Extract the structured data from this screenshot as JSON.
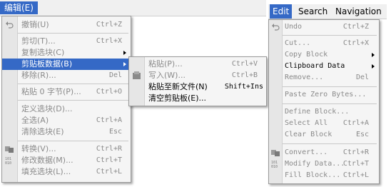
{
  "left": {
    "menubar_title": "编辑(E)",
    "items": [
      {
        "label": "撤销(U)",
        "shortcut": "Ctrl+Z",
        "disabled": true,
        "icon": "undo-icon"
      },
      {
        "label": "剪切(T)...",
        "shortcut": "Ctrl+X",
        "disabled": true
      },
      {
        "label": "复制选块(C)",
        "shortcut": "",
        "disabled": true,
        "submenu": true
      },
      {
        "label": "剪贴板数据(B)",
        "shortcut": "",
        "disabled": false,
        "submenu": true,
        "selected": true
      },
      {
        "label": "移除(R)...",
        "shortcut": "Del",
        "disabled": true
      },
      {
        "label": "粘贴 0 字节(P)...",
        "shortcut": "Ctrl+O",
        "disabled": true
      },
      {
        "label": "定义选块(D)...",
        "shortcut": "",
        "disabled": true
      },
      {
        "label": "全选(A)",
        "shortcut": "Ctrl+A",
        "disabled": true
      },
      {
        "label": "清除选块(E)",
        "shortcut": "Esc",
        "disabled": true
      },
      {
        "label": "转换(V)...",
        "shortcut": "Ctrl+R",
        "disabled": true,
        "icon": "convert-icon"
      },
      {
        "label": "修改数据(M)...",
        "shortcut": "Ctrl+T",
        "disabled": true,
        "icon": "binary-icon"
      },
      {
        "label": "填充选块(L)...",
        "shortcut": "Ctrl+L",
        "disabled": true
      }
    ],
    "submenu": [
      {
        "label": "粘贴(P)...",
        "shortcut": "Ctrl+V",
        "disabled": true
      },
      {
        "label": "写入(W)...",
        "shortcut": "Ctrl+B",
        "disabled": true,
        "icon": "write-icon"
      },
      {
        "label": "粘贴至新文件(N)",
        "shortcut": "Shift+Ins",
        "disabled": false
      },
      {
        "label": "清空剪贴板(E)...",
        "shortcut": "",
        "disabled": false
      }
    ]
  },
  "right": {
    "menubar": [
      "Edit",
      "Search",
      "Navigation"
    ],
    "items": [
      {
        "label": "Undo",
        "shortcut": "Ctrl+Z",
        "disabled": true,
        "icon": "undo-icon"
      },
      {
        "label": "Cut...",
        "shortcut": "Ctrl+X",
        "disabled": true
      },
      {
        "label": "Copy Block",
        "shortcut": "",
        "disabled": true,
        "submenu": true
      },
      {
        "label": "Clipboard Data",
        "shortcut": "",
        "disabled": false,
        "submenu": true
      },
      {
        "label": "Remove...",
        "shortcut": "Del",
        "disabled": true
      },
      {
        "label": "Paste Zero Bytes...",
        "shortcut": "",
        "disabled": true
      },
      {
        "label": "Define Block...",
        "shortcut": "",
        "disabled": true
      },
      {
        "label": "Select All",
        "shortcut": "Ctrl+A",
        "disabled": true
      },
      {
        "label": "Clear Block",
        "shortcut": "Esc",
        "disabled": true
      },
      {
        "label": "Convert...",
        "shortcut": "Ctrl+R",
        "disabled": true,
        "icon": "convert-icon"
      },
      {
        "label": "Modify Data...",
        "shortcut": "Ctrl+T",
        "disabled": true,
        "icon": "binary-icon"
      },
      {
        "label": "Fill Block...",
        "shortcut": "Ctrl+L",
        "disabled": true
      }
    ]
  },
  "colors": {
    "accent": "#3569c6",
    "disabled_text": "#8a8a8a",
    "menu_bg": "#f5f5f5"
  }
}
